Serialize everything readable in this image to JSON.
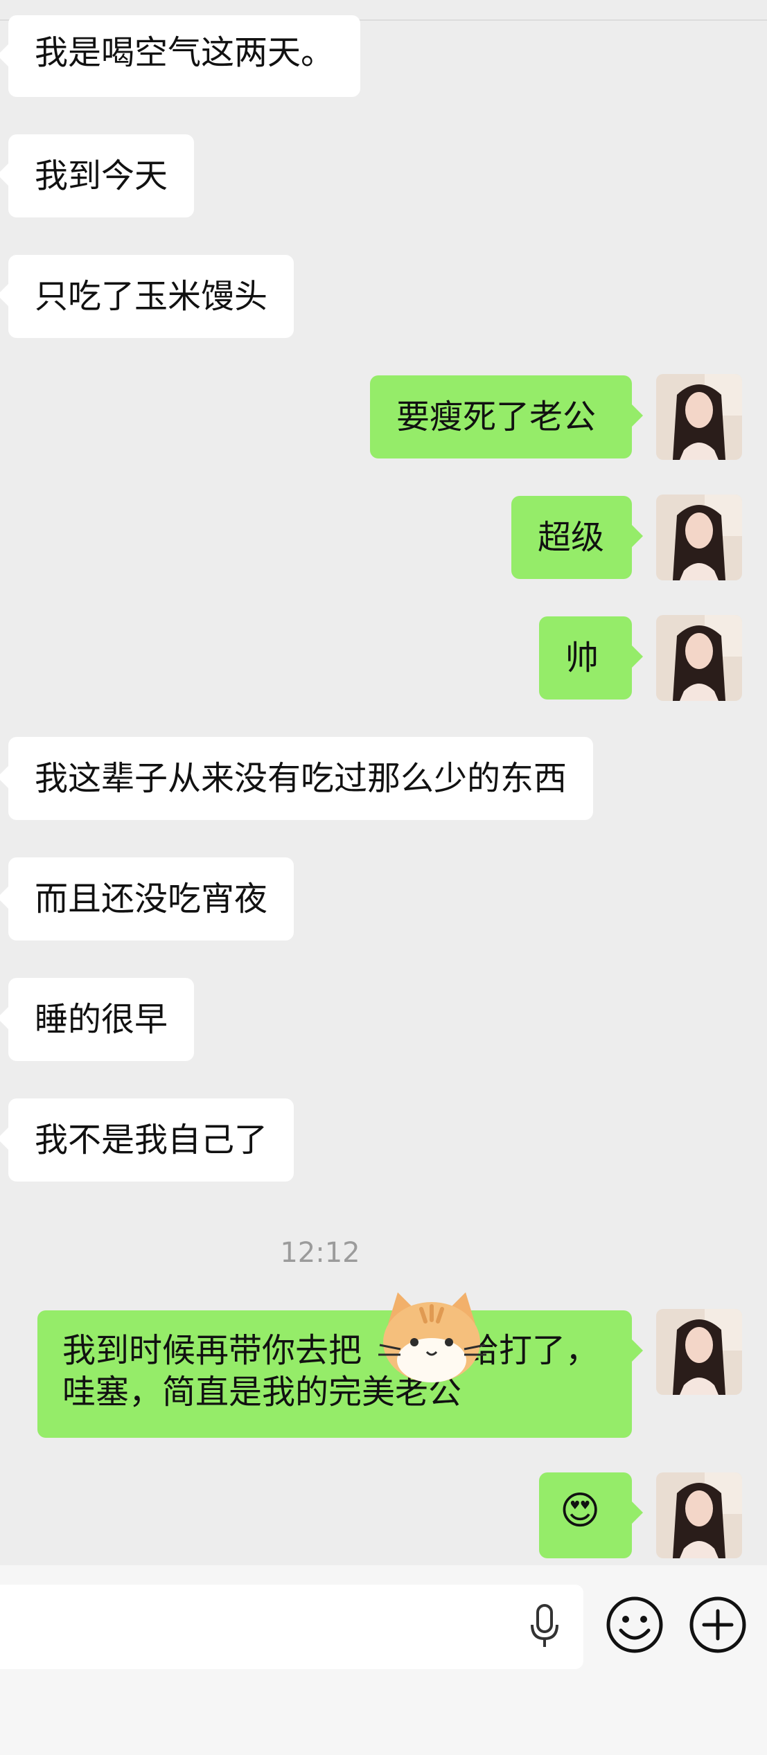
{
  "messages": [
    {
      "side": "in",
      "text": "我是喝空气这两天。"
    },
    {
      "side": "in",
      "text": "我到今天"
    },
    {
      "side": "in",
      "text": "只吃了玉米馒头"
    },
    {
      "side": "out",
      "text": "要瘦死了老公"
    },
    {
      "side": "out",
      "text": "超级"
    },
    {
      "side": "out",
      "text": "帅"
    },
    {
      "side": "in",
      "text": "我这辈子从来没有吃过那么少的东西"
    },
    {
      "side": "in",
      "text": "而且还没吃宵夜"
    },
    {
      "side": "in",
      "text": "睡的很早"
    },
    {
      "side": "in",
      "text": "我不是我自己了"
    },
    {
      "side": "out",
      "line1": "我到时候再带你去把",
      "line1b": "给打了，",
      "line2": "哇塞，简直是我的完美老公"
    },
    {
      "side": "out",
      "emoji": "😍"
    }
  ],
  "timestamp": "12:12",
  "avatar_icon": "user-avatar-icon",
  "input_bar": {
    "mic_icon": "microphone-icon",
    "emoji_icon": "emoji-face-icon",
    "plus_icon": "plus-circle-icon"
  },
  "colors": {
    "outgoing": "#95ec69",
    "incoming": "#ffffff",
    "background": "#ededed"
  }
}
